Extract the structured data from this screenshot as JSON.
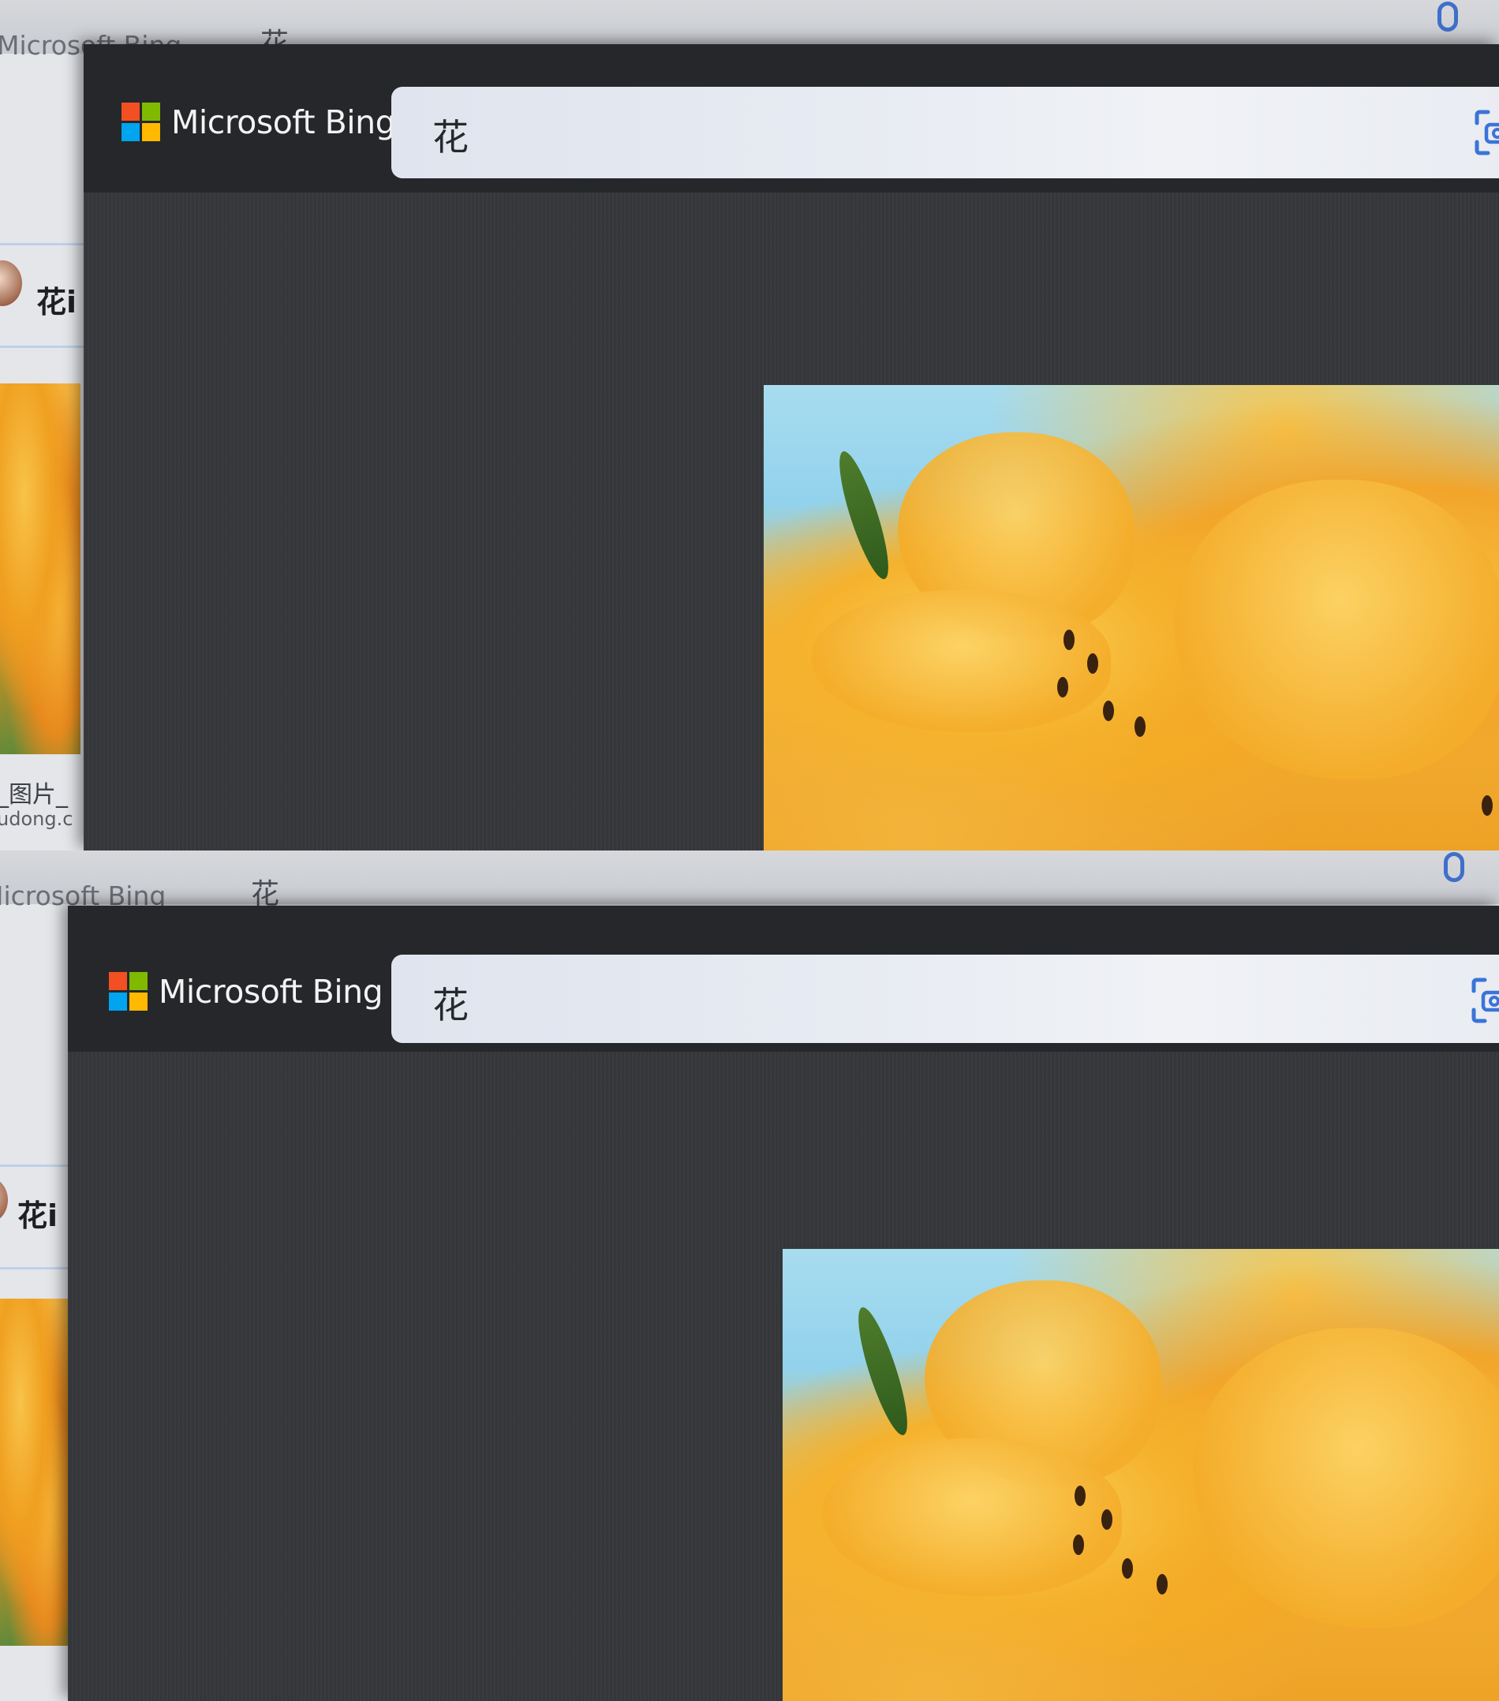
{
  "bing": {
    "brand": "Microsoft Bing",
    "query": "花",
    "icons": [
      "microsoft-logo",
      "visual-search-icon",
      "mic-icon"
    ],
    "logo_colors": [
      "#f25022",
      "#7fba00",
      "#00a4ef",
      "#ffb900"
    ],
    "accent_color": "#3a74d8"
  },
  "background_page": {
    "brand": "Microsoft Bing",
    "query": "花",
    "result_title": "花i",
    "result_caption": "_图片_",
    "result_url": "udong.c"
  },
  "screenshots": [
    {
      "label": "top"
    },
    {
      "label": "bottom"
    }
  ]
}
